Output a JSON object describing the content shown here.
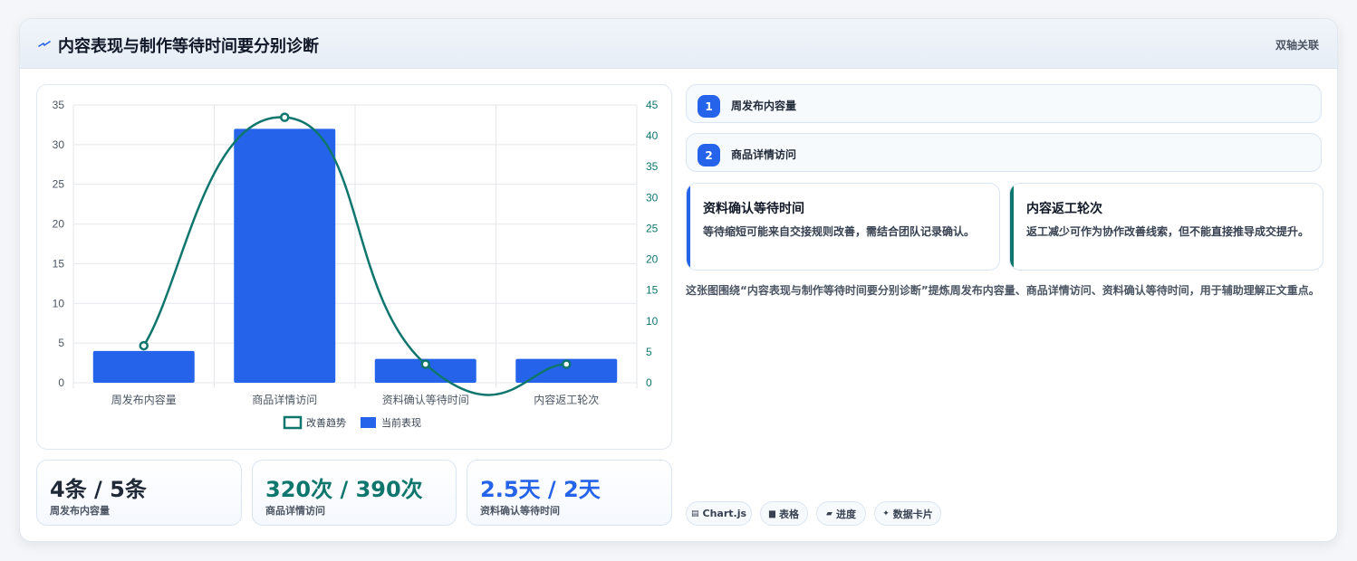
{
  "header": {
    "title": "内容表现与制作等待时间要分别诊断",
    "right_label": "双轴关联",
    "icon": "lightning-icon"
  },
  "chart_data": {
    "type": "bar",
    "categories": [
      "周发布内容量",
      "商品详情访问",
      "资料确认等待时间",
      "内容返工轮次"
    ],
    "series": [
      {
        "name": "当前表现",
        "type": "bar",
        "axis": "left",
        "color": "#2563eb",
        "values": [
          4,
          32,
          3,
          3
        ]
      },
      {
        "name": "改善趋势",
        "type": "line",
        "axis": "right",
        "color": "#0f766e",
        "values": [
          6,
          43,
          3,
          3
        ]
      }
    ],
    "y_left": {
      "min": 0,
      "max": 35,
      "ticks": [
        0,
        5,
        10,
        15,
        20,
        25,
        30,
        35
      ]
    },
    "y_right": {
      "min": 0,
      "max": 45,
      "ticks": [
        0,
        5,
        10,
        15,
        20,
        25,
        30,
        35,
        40,
        45
      ]
    },
    "grid": true,
    "legend_position": "bottom"
  },
  "stats": [
    {
      "value": "4条 / 5条",
      "label": "周发布内容量",
      "color": "#1f2937"
    },
    {
      "value": "320次 / 390次",
      "label": "商品详情访问",
      "color": "#0f766e"
    },
    {
      "value": "2.5天 / 2天",
      "label": "资料确认等待时间",
      "color": "#2563eb"
    }
  ],
  "items": [
    {
      "num": "1",
      "label": "周发布内容量"
    },
    {
      "num": "2",
      "label": "商品详情访问"
    }
  ],
  "notes": [
    {
      "title": "资料确认等待时间",
      "text": "等待缩短可能来自交接规则改善，需结合团队记录确认。",
      "accent": "#2563eb"
    },
    {
      "title": "内容返工轮次",
      "text": "返工减少可作为协作改善线索，但不能直接推导成交提升。",
      "accent": "#0f766e"
    }
  ],
  "summary": "这张图围绕“内容表现与制作等待时间要分别诊断”提炼周发布内容量、商品详情访问、资料确认等待时间，用于辅助理解正文重点。",
  "tags": [
    {
      "icon": "chart-icon",
      "glyph": "▤",
      "label": "Chart.js"
    },
    {
      "icon": "table-icon",
      "glyph": "▆",
      "label": "表格"
    },
    {
      "icon": "progress-icon",
      "glyph": "▰",
      "label": "进度"
    },
    {
      "icon": "sparkle-icon",
      "glyph": "✦",
      "label": "数据卡片"
    }
  ]
}
